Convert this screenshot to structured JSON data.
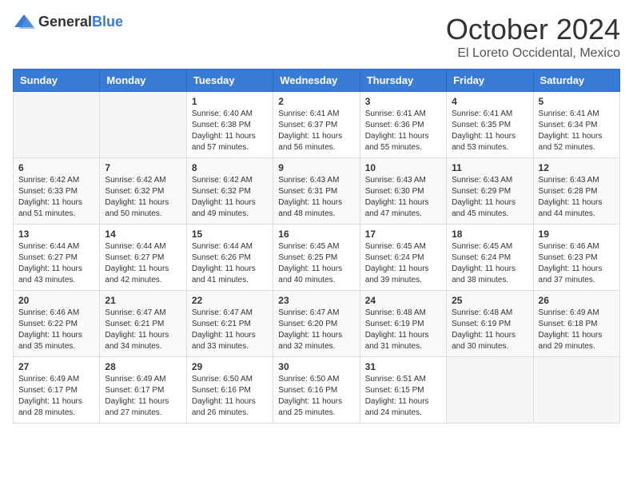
{
  "header": {
    "logo_general": "General",
    "logo_blue": "Blue",
    "month_title": "October 2024",
    "location": "El Loreto Occidental, Mexico"
  },
  "days_of_week": [
    "Sunday",
    "Monday",
    "Tuesday",
    "Wednesday",
    "Thursday",
    "Friday",
    "Saturday"
  ],
  "weeks": [
    [
      {
        "day": "",
        "info": ""
      },
      {
        "day": "",
        "info": ""
      },
      {
        "day": "1",
        "info": "Sunrise: 6:40 AM\nSunset: 6:38 PM\nDaylight: 11 hours and 57 minutes."
      },
      {
        "day": "2",
        "info": "Sunrise: 6:41 AM\nSunset: 6:37 PM\nDaylight: 11 hours and 56 minutes."
      },
      {
        "day": "3",
        "info": "Sunrise: 6:41 AM\nSunset: 6:36 PM\nDaylight: 11 hours and 55 minutes."
      },
      {
        "day": "4",
        "info": "Sunrise: 6:41 AM\nSunset: 6:35 PM\nDaylight: 11 hours and 53 minutes."
      },
      {
        "day": "5",
        "info": "Sunrise: 6:41 AM\nSunset: 6:34 PM\nDaylight: 11 hours and 52 minutes."
      }
    ],
    [
      {
        "day": "6",
        "info": "Sunrise: 6:42 AM\nSunset: 6:33 PM\nDaylight: 11 hours and 51 minutes."
      },
      {
        "day": "7",
        "info": "Sunrise: 6:42 AM\nSunset: 6:32 PM\nDaylight: 11 hours and 50 minutes."
      },
      {
        "day": "8",
        "info": "Sunrise: 6:42 AM\nSunset: 6:32 PM\nDaylight: 11 hours and 49 minutes."
      },
      {
        "day": "9",
        "info": "Sunrise: 6:43 AM\nSunset: 6:31 PM\nDaylight: 11 hours and 48 minutes."
      },
      {
        "day": "10",
        "info": "Sunrise: 6:43 AM\nSunset: 6:30 PM\nDaylight: 11 hours and 47 minutes."
      },
      {
        "day": "11",
        "info": "Sunrise: 6:43 AM\nSunset: 6:29 PM\nDaylight: 11 hours and 45 minutes."
      },
      {
        "day": "12",
        "info": "Sunrise: 6:43 AM\nSunset: 6:28 PM\nDaylight: 11 hours and 44 minutes."
      }
    ],
    [
      {
        "day": "13",
        "info": "Sunrise: 6:44 AM\nSunset: 6:27 PM\nDaylight: 11 hours and 43 minutes."
      },
      {
        "day": "14",
        "info": "Sunrise: 6:44 AM\nSunset: 6:27 PM\nDaylight: 11 hours and 42 minutes."
      },
      {
        "day": "15",
        "info": "Sunrise: 6:44 AM\nSunset: 6:26 PM\nDaylight: 11 hours and 41 minutes."
      },
      {
        "day": "16",
        "info": "Sunrise: 6:45 AM\nSunset: 6:25 PM\nDaylight: 11 hours and 40 minutes."
      },
      {
        "day": "17",
        "info": "Sunrise: 6:45 AM\nSunset: 6:24 PM\nDaylight: 11 hours and 39 minutes."
      },
      {
        "day": "18",
        "info": "Sunrise: 6:45 AM\nSunset: 6:24 PM\nDaylight: 11 hours and 38 minutes."
      },
      {
        "day": "19",
        "info": "Sunrise: 6:46 AM\nSunset: 6:23 PM\nDaylight: 11 hours and 37 minutes."
      }
    ],
    [
      {
        "day": "20",
        "info": "Sunrise: 6:46 AM\nSunset: 6:22 PM\nDaylight: 11 hours and 35 minutes."
      },
      {
        "day": "21",
        "info": "Sunrise: 6:47 AM\nSunset: 6:21 PM\nDaylight: 11 hours and 34 minutes."
      },
      {
        "day": "22",
        "info": "Sunrise: 6:47 AM\nSunset: 6:21 PM\nDaylight: 11 hours and 33 minutes."
      },
      {
        "day": "23",
        "info": "Sunrise: 6:47 AM\nSunset: 6:20 PM\nDaylight: 11 hours and 32 minutes."
      },
      {
        "day": "24",
        "info": "Sunrise: 6:48 AM\nSunset: 6:19 PM\nDaylight: 11 hours and 31 minutes."
      },
      {
        "day": "25",
        "info": "Sunrise: 6:48 AM\nSunset: 6:19 PM\nDaylight: 11 hours and 30 minutes."
      },
      {
        "day": "26",
        "info": "Sunrise: 6:49 AM\nSunset: 6:18 PM\nDaylight: 11 hours and 29 minutes."
      }
    ],
    [
      {
        "day": "27",
        "info": "Sunrise: 6:49 AM\nSunset: 6:17 PM\nDaylight: 11 hours and 28 minutes."
      },
      {
        "day": "28",
        "info": "Sunrise: 6:49 AM\nSunset: 6:17 PM\nDaylight: 11 hours and 27 minutes."
      },
      {
        "day": "29",
        "info": "Sunrise: 6:50 AM\nSunset: 6:16 PM\nDaylight: 11 hours and 26 minutes."
      },
      {
        "day": "30",
        "info": "Sunrise: 6:50 AM\nSunset: 6:16 PM\nDaylight: 11 hours and 25 minutes."
      },
      {
        "day": "31",
        "info": "Sunrise: 6:51 AM\nSunset: 6:15 PM\nDaylight: 11 hours and 24 minutes."
      },
      {
        "day": "",
        "info": ""
      },
      {
        "day": "",
        "info": ""
      }
    ]
  ]
}
